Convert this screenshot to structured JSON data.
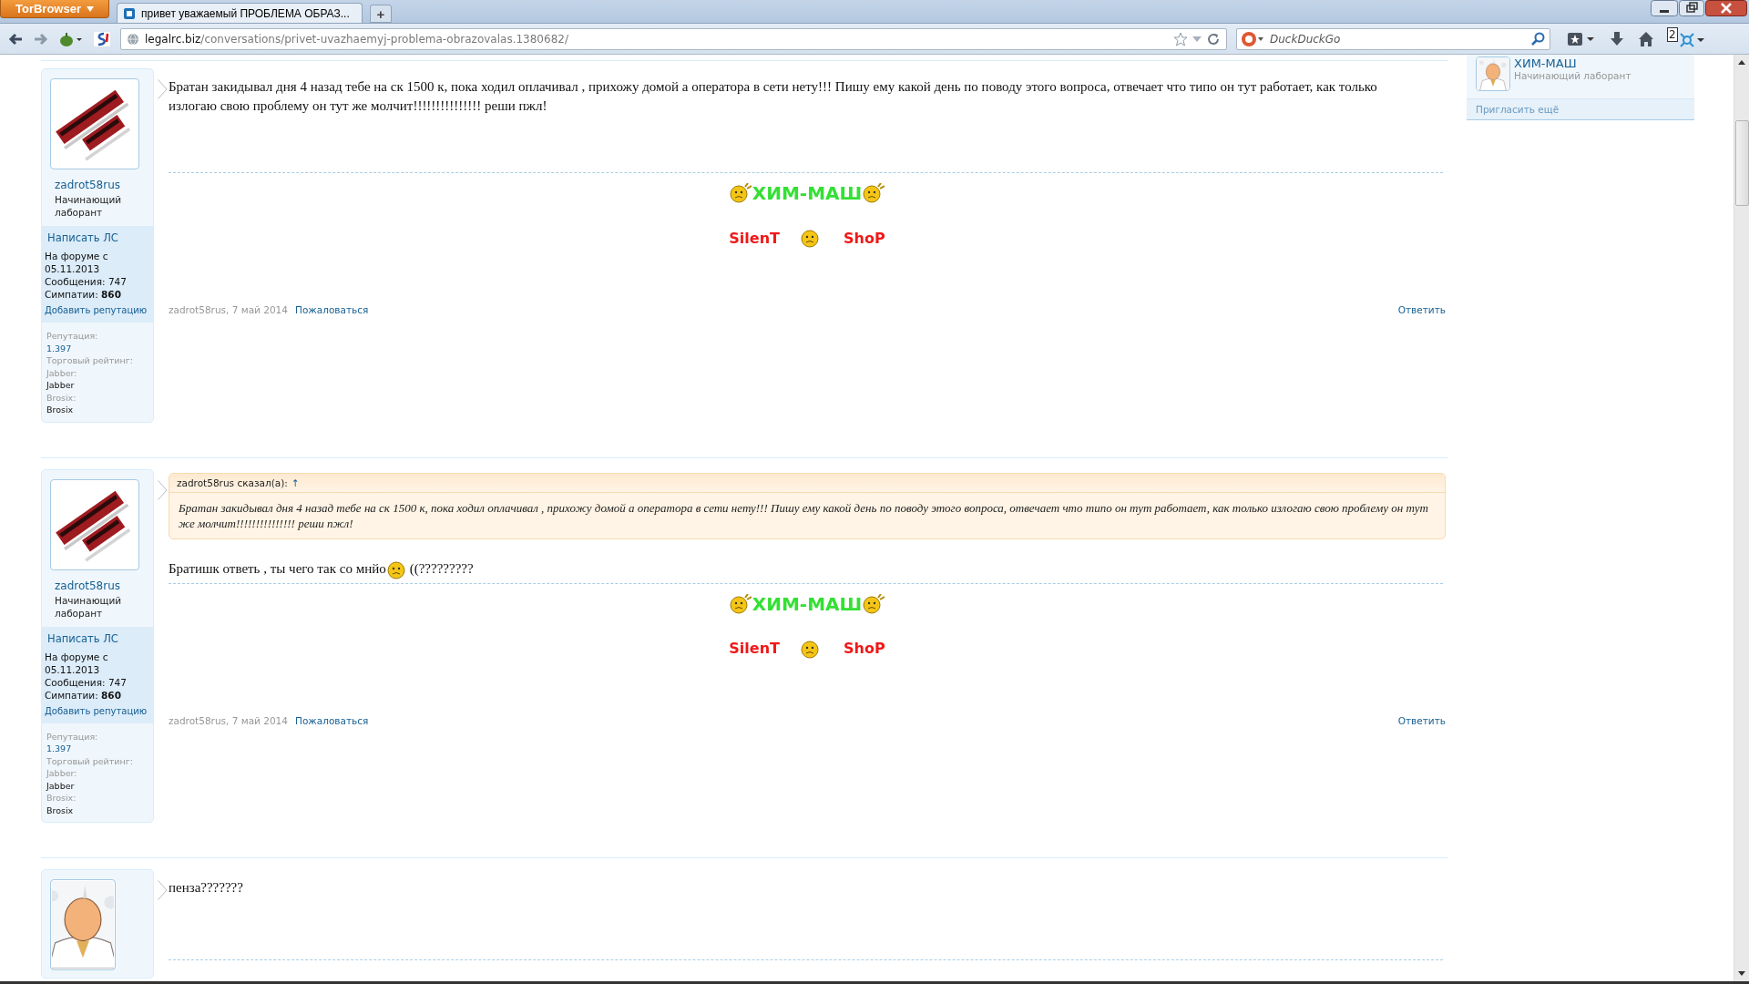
{
  "browser": {
    "menu_button": "TorBrowser",
    "tabs": [
      {
        "title": "привет уважаемый ПРОБЛЕМА ОБРАЗ...",
        "selected": true
      }
    ],
    "new_tab": "+",
    "url": {
      "host": "legalrc.biz",
      "path": "/conversations/privet-uvazhaemyj-problema-obrazovalas.1380682/"
    },
    "search": {
      "placeholder": "DuckDuckGo"
    },
    "badge": "2"
  },
  "posts": [
    {
      "author": "zadrot58rus",
      "user_title": "Начинающий лаборант",
      "pm_link": "Написать ЛС",
      "joined_label": "На форуме с",
      "joined": "05.11.2013",
      "messages_label": "Сообщения:",
      "messages": "747",
      "likes_label": "Симпатии:",
      "likes": "860",
      "rep_link": "Добавить репутацию",
      "extras": [
        {
          "label": "Репутация:",
          "value": "1.397",
          "kind": "link"
        },
        {
          "label": "Торговый рейтинг:"
        },
        {
          "label": "Jabber:",
          "value": "Jabber",
          "kind": "text"
        },
        {
          "label": "Brosix:",
          "value": "Brosix",
          "kind": "text"
        }
      ],
      "text": "Братан закидывал дня 4 назад тебе на ск 1500 к, пока ходил оплачивал , прихожу домой а оператора в сети нету!!! Пишу ему какой день по поводу этого вопроса, отвечает что типо он тут работает, как только излогаю свою проблему он тут же молчит!!!!!!!!!!!!!!! реши пжл!",
      "signature": {
        "title": "ХИМ-МАШ",
        "left": "SilenT",
        "right": "ShoP"
      },
      "byline": "zadrot58rus, 7 май 2014",
      "report": "Пожаловаться",
      "reply": "Ответить"
    },
    {
      "author": "zadrot58rus",
      "user_title": "Начинающий лаборант",
      "pm_link": "Написать ЛС",
      "joined_label": "На форуме с",
      "joined": "05.11.2013",
      "messages_label": "Сообщения:",
      "messages": "747",
      "likes_label": "Симпатии:",
      "likes": "860",
      "rep_link": "Добавить репутацию",
      "extras": [
        {
          "label": "Репутация:",
          "value": "1.397",
          "kind": "link"
        },
        {
          "label": "Торговый рейтинг:"
        },
        {
          "label": "Jabber:",
          "value": "Jabber",
          "kind": "text"
        },
        {
          "label": "Brosix:",
          "value": "Brosix",
          "kind": "text"
        }
      ],
      "quote": {
        "author_line": "zadrot58rus сказал(а):",
        "arrow": "↑",
        "text": "Братан закидывал дня 4 назад тебе на ск 1500 к, пока ходил оплачивал , прихожу домой а оператора в сети нету!!! Пишу ему какой день по поводу этого вопроса, отвечает что типо он тут работает, как только излогаю свою проблему он тут же молчит!!!!!!!!!!!!!!! реши пжл!"
      },
      "text": "Братишк ответь , ты чего так со мнйо",
      "text_after": "((?????????",
      "signature": {
        "title": "ХИМ-МАШ",
        "left": "SilenT",
        "right": "ShoP"
      },
      "byline": "zadrot58rus, 7 май 2014",
      "report": "Пожаловаться",
      "reply": "Ответить"
    },
    {
      "text": "пенза???????"
    }
  ],
  "sidebar": {
    "participants": [
      {
        "name": "ХИМ-МАШ",
        "title": "Начинающий лаборант"
      }
    ],
    "invite": "Пригласить ещё"
  }
}
